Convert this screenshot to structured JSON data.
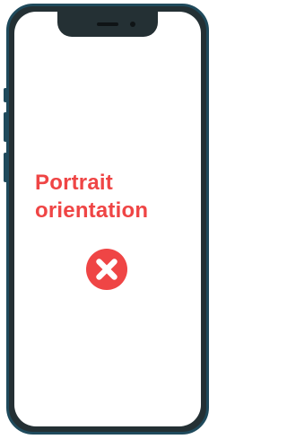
{
  "orientation_notice": {
    "line1": "Portrait",
    "line2": "orientation",
    "status_icon": "close-circle-icon",
    "accent_color": "#ef4545"
  },
  "device": {
    "frame_color": "#1f4a5c",
    "bezel_color": "#243034"
  }
}
